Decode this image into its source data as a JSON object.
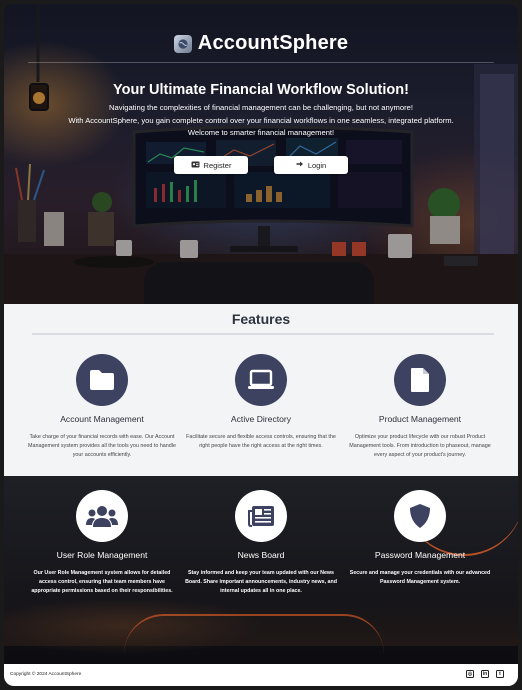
{
  "brand": {
    "name": "AccountSphere",
    "logo_icon": "globe-icon"
  },
  "hero": {
    "title": "Your Ultimate Financial Workflow Solution!",
    "line1": "Navigating the complexities of financial management can be challenging, but not anymore!",
    "line2": "With AccountSphere, you gain complete control over your financial workflows in one seamless, integrated platform.",
    "line3": "Welcome to smarter financial management!",
    "register_label": "Register",
    "login_label": "Login"
  },
  "features": {
    "title": "Features",
    "items": [
      {
        "title": "Account Management",
        "icon": "folder-icon",
        "desc": "Take charge of your financial records with ease. Our Account Management system provides all the tools you need to handle your accounts efficiently."
      },
      {
        "title": "Active Directory",
        "icon": "laptop-icon",
        "desc": "Facilitate secure and flexible access controls, ensuring that the right people have the right access at the right times."
      },
      {
        "title": "Product Management",
        "icon": "document-icon",
        "desc": "Optimize your product lifecycle with our robust Product Management tools. From introduction to phaseout, manage every aspect of your product's journey."
      },
      {
        "title": "User Role Management",
        "icon": "users-icon",
        "desc": "Our User Role Management system allows for detailed access control, ensuring that team members have appropriate permissions based on their responsibilities."
      },
      {
        "title": "News Board",
        "icon": "newspaper-icon",
        "desc": "Stay informed and keep your team updated with our News Board. Share important announcements, industry news, and internal updates all in one place."
      },
      {
        "title": "Password Management",
        "icon": "shield-icon",
        "desc": "Secure and manage your credentials with our advanced Password Management system."
      }
    ]
  },
  "footer": {
    "copyright": "Copyright © 2024 AccountSphere",
    "social": [
      "instagram-icon",
      "linkedin-icon",
      "twitter-icon"
    ]
  },
  "colors": {
    "icon_circle": "#3d4260",
    "light_section": "#f3f4f6",
    "accent_orange": "#ff6a2a"
  }
}
